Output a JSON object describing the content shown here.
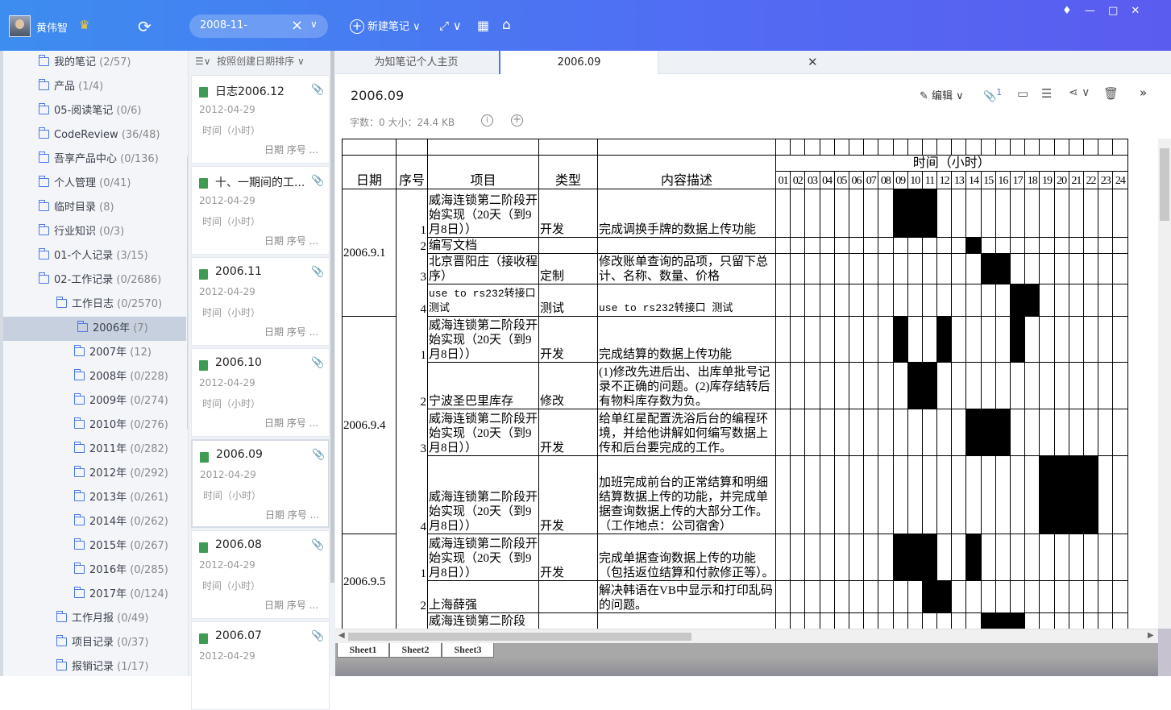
{
  "titlebar": {
    "username": "黄伟智",
    "search_value": "2008-11-",
    "new_note_label": "新建笔记"
  },
  "sidebar": {
    "folders": [
      {
        "name": "我的笔记",
        "count": "(2/57)"
      },
      {
        "name": "产品",
        "count": "(1/4)"
      },
      {
        "name": "05-阅读笔记",
        "count": "(0/6)"
      },
      {
        "name": "CodeReview",
        "count": "(36/48)"
      },
      {
        "name": "吾享产品中心",
        "count": "(0/136)"
      },
      {
        "name": "个人管理",
        "count": "(0/41)"
      },
      {
        "name": "临时目录",
        "count": "(8)"
      },
      {
        "name": "行业知识",
        "count": "(0/3)"
      },
      {
        "name": "01-个人记录",
        "count": "(3/15)"
      },
      {
        "name": "02-工作记录",
        "count": "(0/2686)"
      },
      {
        "name": "工作日志",
        "count": "(0/2570)"
      },
      {
        "name": "2006年",
        "count": "(7)"
      },
      {
        "name": "2007年",
        "count": "(12)"
      },
      {
        "name": "2008年",
        "count": "(0/228)"
      },
      {
        "name": "2009年",
        "count": "(0/274)"
      },
      {
        "name": "2010年",
        "count": "(0/276)"
      },
      {
        "name": "2011年",
        "count": "(0/282)"
      },
      {
        "name": "2012年",
        "count": "(0/292)"
      },
      {
        "name": "2013年",
        "count": "(0/261)"
      },
      {
        "name": "2014年",
        "count": "(0/262)"
      },
      {
        "name": "2015年",
        "count": "(0/267)"
      },
      {
        "name": "2016年",
        "count": "(0/285)"
      },
      {
        "name": "2017年",
        "count": "(0/124)"
      },
      {
        "name": "工作月报",
        "count": "(0/49)"
      },
      {
        "name": "项目记录",
        "count": "(0/37)"
      },
      {
        "name": "报销记录",
        "count": "(1/17)"
      }
    ]
  },
  "notelist": {
    "sort_label": "按照创建日期排序",
    "notes": [
      {
        "title": "日志2006.12",
        "date": "2012-04-29",
        "line1": "时间（小时）",
        "line2": "日期 序号 ..."
      },
      {
        "title": "十、一期间的工...",
        "date": "2012-04-29",
        "line1": "时间（小时）",
        "line2": "日期 序号 ..."
      },
      {
        "title": "2006.11",
        "date": "2012-04-29",
        "line1": "时间（小时）",
        "line2": "日期 序号 ..."
      },
      {
        "title": "2006.10",
        "date": "2012-04-29",
        "line1": "时间（小时）",
        "line2": "日期 序号 ..."
      },
      {
        "title": "2006.09",
        "date": "2012-04-29",
        "line1": "时间（小时）",
        "line2": "日期 序号 ..."
      },
      {
        "title": "2006.08",
        "date": "2012-04-29",
        "line1": "时间（小时）",
        "line2": "日期 序号 ..."
      },
      {
        "title": "2006.07",
        "date": "2012-04-29",
        "line1": "",
        "line2": ""
      }
    ]
  },
  "tabs": {
    "home": "为知笔记个人主页",
    "active": "2006.09"
  },
  "note": {
    "title": "2006.09",
    "meta": "字数：0    大小：24.4 KB",
    "edit_label": "编辑",
    "attach_count": "1"
  },
  "sheet": {
    "headers": {
      "date": "日期",
      "seq": "序号",
      "project": "项目",
      "type": "类型",
      "desc": "内容描述",
      "time": "时间（小时）"
    },
    "hours": [
      "01",
      "02",
      "03",
      "04",
      "05",
      "06",
      "07",
      "08",
      "09",
      "10",
      "11",
      "12",
      "13",
      "14",
      "15",
      "16",
      "17",
      "18",
      "19",
      "20",
      "21",
      "22",
      "23",
      "24"
    ],
    "rows": [
      {
        "date": "2006.9.1",
        "seq": "1",
        "project": "威海连锁第二阶段开始实现（20天（到9月8日））",
        "type": "开发",
        "desc": "完成调换手牌的数据上传功能"
      },
      {
        "date": "",
        "seq": "2",
        "project": "编写文档",
        "type": "",
        "desc": ""
      },
      {
        "date": "",
        "seq": "3",
        "project": "北京晋阳庄（接收程序）",
        "type": "定制",
        "desc": "修改账单查询的品项，只留下总计、名称、数量、价格"
      },
      {
        "date": "",
        "seq": "4",
        "project": "use to rs232转接口测试",
        "type": "测试",
        "desc": "use to rs232转接口 测试"
      },
      {
        "date": "2006.9.4",
        "seq": "1",
        "project": "威海连锁第二阶段开始实现（20天（到9月8日））",
        "type": "开发",
        "desc": "完成结算的数据上传功能"
      },
      {
        "date": "",
        "seq": "2",
        "project": "宁波圣巴里库存",
        "type": "修改",
        "desc": "(1)修改先进后出、出库单批号记录不正确的问题。(2)库存结转后有物料库存数为负。"
      },
      {
        "date": "",
        "seq": "3",
        "project": "威海连锁第二阶段开始实现（20天（到9月8日））",
        "type": "开发",
        "desc": "给单红星配置洗浴后台的编程环境，并给他讲解如何编写数据上传和后台要完成的工作。"
      },
      {
        "date": "",
        "seq": "4",
        "project": "威海连锁第二阶段开始实现（20天（到9月8日））",
        "type": "开发",
        "desc": "加班完成前台的正常结算和明细结算数据上传的功能，并完成单据查询数据上传的大部分工作。（工作地点：公司宿舍）"
      },
      {
        "date": "2006.9.5",
        "seq": "1",
        "project": "威海连锁第二阶段开始实现（20天（到9月8日））",
        "type": "开发",
        "desc": "完成单据查询数据上传的功能（包括返位结算和付款修正等）。"
      },
      {
        "date": "",
        "seq": "2",
        "project": "上海薛强",
        "type": "",
        "desc": "解决韩语在VB中显示和打印乱码的问题。"
      },
      {
        "date": "",
        "seq": "",
        "project": "威海连锁第二阶段",
        "type": "",
        "desc": ""
      }
    ],
    "sheet_tabs": [
      "Sheet1",
      "Sheet2",
      "Sheet3"
    ]
  }
}
